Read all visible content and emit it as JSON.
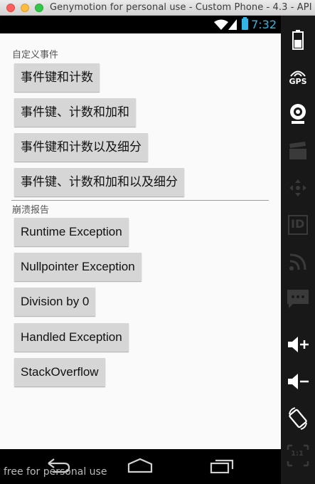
{
  "window": {
    "title": "Genymotion for personal use - Custom Phone - 4.3 - API..."
  },
  "statusbar": {
    "time": "7:32"
  },
  "content": {
    "section1_label": "自定义事件",
    "section1_buttons": [
      "事件键和计数",
      "事件键、计数和加和",
      "事件键和计数以及细分",
      "事件键、计数和加和以及细分"
    ],
    "section2_label": "崩溃报告",
    "section2_buttons": [
      "Runtime Exception",
      "Nullpointer Exception",
      "Division by 0",
      "Handled Exception",
      "StackOverflow"
    ]
  },
  "watermark": "free for personal use",
  "sidebar": {
    "gps_label": "GPS",
    "id_label": "ID",
    "scale_label": "1:1",
    "icons": [
      "battery-icon",
      "gps-icon",
      "webcam-icon",
      "clapper-icon",
      "dpad-icon",
      "id-icon",
      "rss-icon",
      "sms-icon",
      "volume-up-icon",
      "volume-down-icon",
      "rotate-icon",
      "scale-icon"
    ]
  },
  "colors": {
    "accent": "#33b5e5",
    "button_bg": "#d6d6d6",
    "screen_bg": "#fafafa"
  }
}
